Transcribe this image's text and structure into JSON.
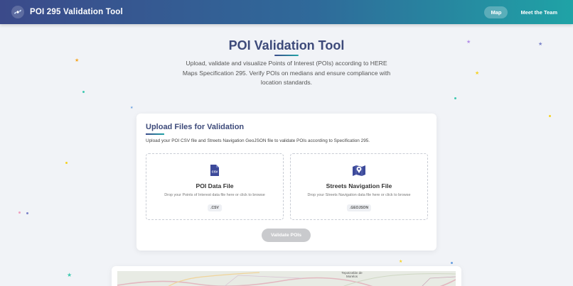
{
  "header": {
    "title": "POI 295 Validation Tool",
    "nav": {
      "map": "Map",
      "team": "Meet the Team"
    }
  },
  "hero": {
    "title": "POI Validation Tool",
    "description": "Upload, validate and visualize Points of Interest (POIs) according to HERE Maps Specification 295. Verify POIs on medians and ensure compliance with location standards."
  },
  "upload": {
    "title": "Upload Files for Validation",
    "subtitle": "Upload your POI CSV file and Streets Navigation GeoJSON file to validate POIs according to Specification 295.",
    "poi": {
      "title": "POI Data File",
      "desc": "Drop your Points of Interest data file here or click to browse",
      "badge": ".CSV",
      "icon_text": "CSV"
    },
    "streets": {
      "title": "Streets Navigation File",
      "desc": "Drop your Streets Navigation data file here or click to browse",
      "badge": ".GEOJSON"
    },
    "button": "Validate POIs"
  },
  "map": {
    "labels": [
      "Tepotzotlán de Morelos"
    ]
  },
  "colors": {
    "accent": "#3d4a7a",
    "header_start": "#3b4a8a",
    "header_end": "#1fa3a6"
  },
  "icons": {
    "brand": "satellite-icon",
    "poi_file": "csv-file-icon",
    "streets_file": "map-marker-icon"
  }
}
